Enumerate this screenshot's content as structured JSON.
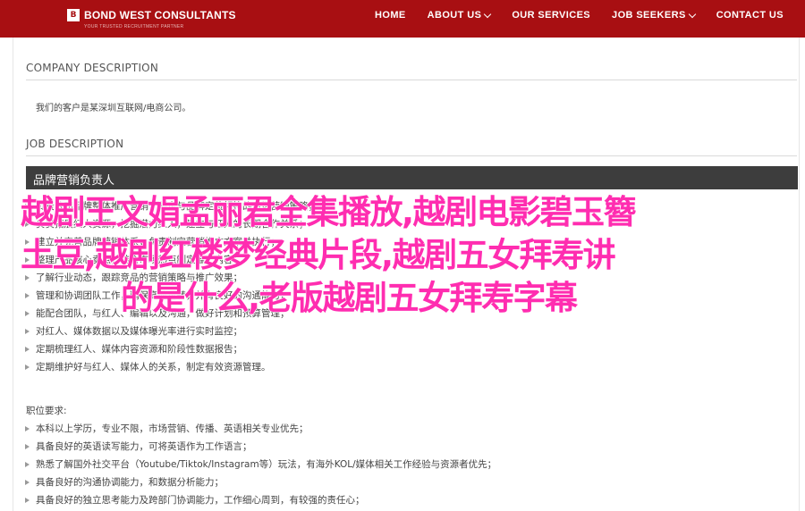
{
  "nav": {
    "logo_mark": "B",
    "logo_text": "BOND WEST CONSULTANTS",
    "logo_tagline": "YOUR TRUSTED RECRUITMENT PARTNER",
    "menu": [
      {
        "label": "HOME"
      },
      {
        "label": "ABOUT US",
        "dropdown": true
      },
      {
        "label": "OUR SERVICES"
      },
      {
        "label": "JOB SEEKERS",
        "dropdown": true
      },
      {
        "label": "CONTACT US"
      }
    ],
    "bg_color": "#a80f12"
  },
  "company": {
    "heading": "COMPANY DESCRIPTION",
    "text": "我们的客户是某深圳互联网/电商公司。"
  },
  "job": {
    "heading": "JOB DESCRIPTION",
    "title": "品牌营销负责人",
    "duties": [
      "负责公司品牌整体推广营销，制定与品牌定位相符的市场营销策略；",
      "负责拓展红人资源，挖掘潜力红人，建立与红人的长期合作关系；",
      "建立并完善品牌营销体系，负责制定营销推广方案并执行；",
      "整理产品核心卖点，结合市场热点制定推广内容；",
      "了解行业动态，跟踪竞品的营销策略与推广效果；",
      "管理和协调团队工作，确保高效运转，并有良好的沟通能力；",
      "能配合团队，与红人、编辑以及沟通，做好计划和预算管理；",
      "对红人、媒体数据以及媒体曝光率进行实时监控；",
      "定期梳理红人、媒体内容资源和阶段性数据报告；",
      "定期维护好与红人、媒体人的关系，制定有效资源管理。"
    ]
  },
  "requirements": {
    "heading": "职位要求:",
    "items": [
      "本科以上学历，专业不限，市场营销、传播、英语相关专业优先；",
      "具备良好的英语读写能力，可将英语作为工作语言；",
      "熟悉了解国外社交平台（Youtube/Tiktok/Instagram等）玩法，有海外KOL/媒体相关工作经验与资源者优先；",
      "具备良好的沟通协调能力，和数据分析能力；",
      "具备良好的独立思考能力及跨部门协调能力，工作细心周到，有较强的责任心；"
    ]
  },
  "overlay": {
    "lines": [
      "越剧王文娟孟丽君全集播放,越剧电影碧玉簪",
      "土豆,越剧红楼梦经典片段,越剧五女拜寿讲",
      "的是什么,老版越剧五女拜寿字幕"
    ],
    "color": "#ff2db0"
  }
}
